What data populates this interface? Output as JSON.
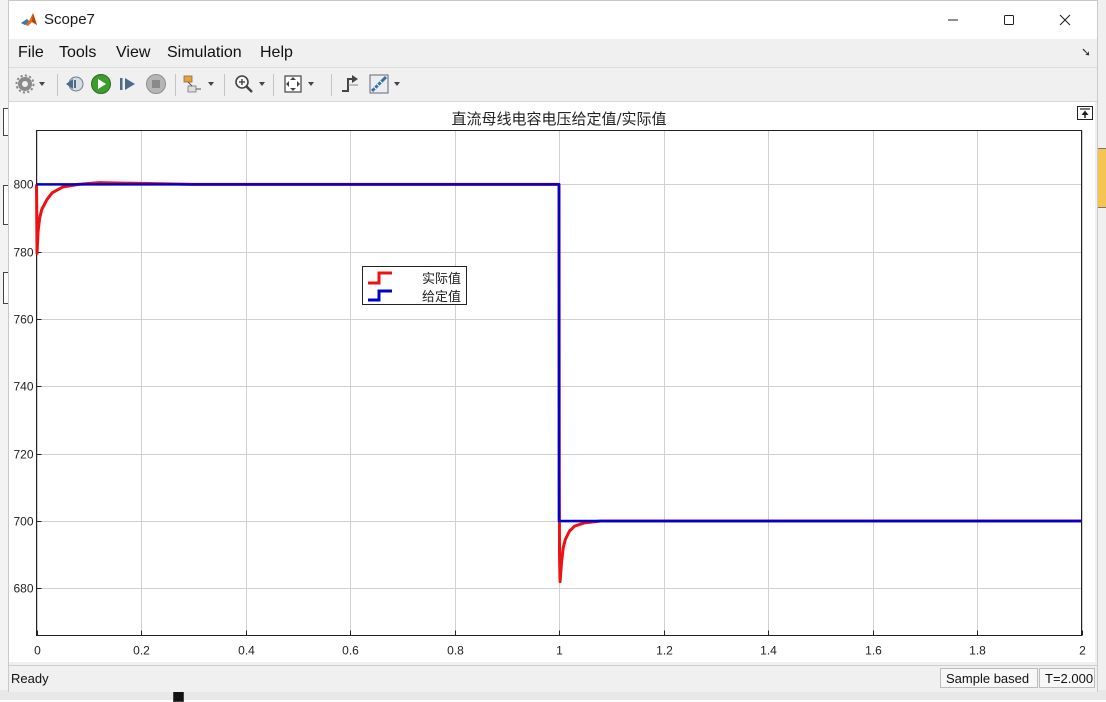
{
  "window": {
    "title": "Scope7",
    "app_icon": "matlab-icon"
  },
  "window_controls": [
    "minimize-icon",
    "maximize-icon",
    "close-icon"
  ],
  "menu": {
    "items": [
      "File",
      "Tools",
      "View",
      "Simulation",
      "Help"
    ],
    "pin_icon": "undock-arrow-icon"
  },
  "toolbar": {
    "icons": [
      "settings-gear-icon",
      "step-back-icon",
      "run-icon",
      "step-forward-icon",
      "stop-icon",
      "highlight-block-icon",
      "zoom-in-icon",
      "fit-to-view-icon",
      "triggers-icon",
      "measurements-icon"
    ]
  },
  "status": {
    "text": "Ready",
    "sample_mode": "Sample based",
    "time": "T=2.000"
  },
  "colors": {
    "actual": "#ee1111",
    "reference": "#0000cc",
    "grid": "#d0d0d0"
  },
  "chart_data": {
    "type": "line",
    "title": "直流母线电容电压给定值/实际值",
    "xlabel": "",
    "ylabel": "",
    "xlim": [
      0,
      2
    ],
    "ylim": [
      666,
      816
    ],
    "x_ticks": [
      "0",
      "0.2",
      "0.4",
      "0.6",
      "0.8",
      "1",
      "1.2",
      "1.4",
      "1.6",
      "1.8",
      "2"
    ],
    "x_tick_values": [
      0,
      0.2,
      0.4,
      0.6,
      0.8,
      1,
      1.2,
      1.4,
      1.6,
      1.8,
      2
    ],
    "y_ticks": [
      "680",
      "700",
      "720",
      "740",
      "760",
      "780",
      "800"
    ],
    "y_tick_values": [
      680,
      700,
      720,
      740,
      760,
      780,
      800
    ],
    "grid": true,
    "legend_position": "upper-left-center",
    "series": [
      {
        "name": "实际值",
        "x": [
          0,
          0.001,
          0.003,
          0.006,
          0.01,
          0.02,
          0.03,
          0.05,
          0.08,
          0.12,
          0.3,
          0.6,
          0.9,
          1.0,
          1.0005,
          1.001,
          1.002,
          1.005,
          1.008,
          1.012,
          1.02,
          1.03,
          1.05,
          1.08,
          1.2,
          1.5,
          2.0
        ],
        "y": [
          800,
          779.5,
          786,
          790,
          792.5,
          795.5,
          797.5,
          799.2,
          800,
          800.5,
          800,
          800,
          800,
          800,
          714.5,
          690,
          682,
          688,
          692,
          694.5,
          697,
          698.5,
          699.5,
          700,
          700,
          700,
          700
        ]
      },
      {
        "name": "给定值",
        "x": [
          0,
          1.0,
          1.0,
          2.0
        ],
        "y": [
          800,
          800,
          700,
          700
        ]
      }
    ]
  }
}
